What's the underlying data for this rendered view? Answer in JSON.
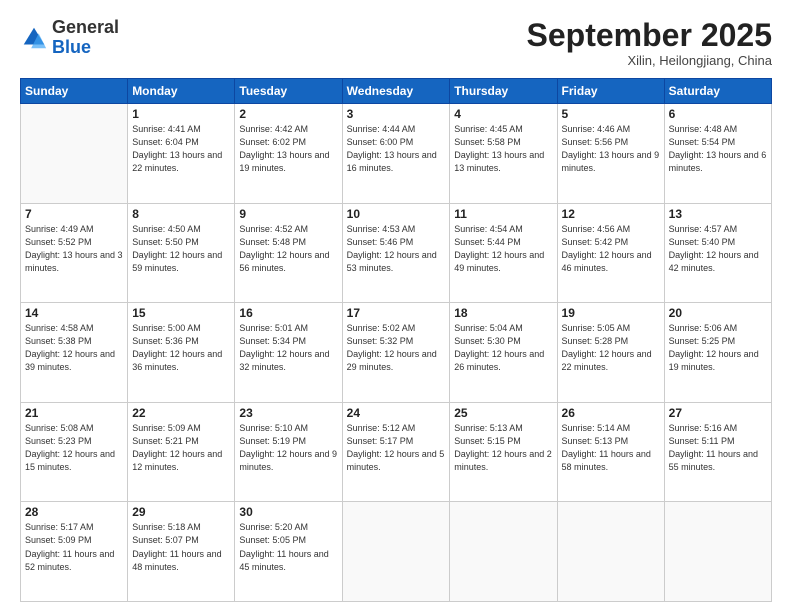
{
  "logo": {
    "general": "General",
    "blue": "Blue"
  },
  "header": {
    "month": "September 2025",
    "location": "Xilin, Heilongjiang, China"
  },
  "weekdays": [
    "Sunday",
    "Monday",
    "Tuesday",
    "Wednesday",
    "Thursday",
    "Friday",
    "Saturday"
  ],
  "weeks": [
    [
      {
        "day": "",
        "detail": ""
      },
      {
        "day": "1",
        "detail": "Sunrise: 4:41 AM\nSunset: 6:04 PM\nDaylight: 13 hours\nand 22 minutes."
      },
      {
        "day": "2",
        "detail": "Sunrise: 4:42 AM\nSunset: 6:02 PM\nDaylight: 13 hours\nand 19 minutes."
      },
      {
        "day": "3",
        "detail": "Sunrise: 4:44 AM\nSunset: 6:00 PM\nDaylight: 13 hours\nand 16 minutes."
      },
      {
        "day": "4",
        "detail": "Sunrise: 4:45 AM\nSunset: 5:58 PM\nDaylight: 13 hours\nand 13 minutes."
      },
      {
        "day": "5",
        "detail": "Sunrise: 4:46 AM\nSunset: 5:56 PM\nDaylight: 13 hours\nand 9 minutes."
      },
      {
        "day": "6",
        "detail": "Sunrise: 4:48 AM\nSunset: 5:54 PM\nDaylight: 13 hours\nand 6 minutes."
      }
    ],
    [
      {
        "day": "7",
        "detail": "Sunrise: 4:49 AM\nSunset: 5:52 PM\nDaylight: 13 hours\nand 3 minutes."
      },
      {
        "day": "8",
        "detail": "Sunrise: 4:50 AM\nSunset: 5:50 PM\nDaylight: 12 hours\nand 59 minutes."
      },
      {
        "day": "9",
        "detail": "Sunrise: 4:52 AM\nSunset: 5:48 PM\nDaylight: 12 hours\nand 56 minutes."
      },
      {
        "day": "10",
        "detail": "Sunrise: 4:53 AM\nSunset: 5:46 PM\nDaylight: 12 hours\nand 53 minutes."
      },
      {
        "day": "11",
        "detail": "Sunrise: 4:54 AM\nSunset: 5:44 PM\nDaylight: 12 hours\nand 49 minutes."
      },
      {
        "day": "12",
        "detail": "Sunrise: 4:56 AM\nSunset: 5:42 PM\nDaylight: 12 hours\nand 46 minutes."
      },
      {
        "day": "13",
        "detail": "Sunrise: 4:57 AM\nSunset: 5:40 PM\nDaylight: 12 hours\nand 42 minutes."
      }
    ],
    [
      {
        "day": "14",
        "detail": "Sunrise: 4:58 AM\nSunset: 5:38 PM\nDaylight: 12 hours\nand 39 minutes."
      },
      {
        "day": "15",
        "detail": "Sunrise: 5:00 AM\nSunset: 5:36 PM\nDaylight: 12 hours\nand 36 minutes."
      },
      {
        "day": "16",
        "detail": "Sunrise: 5:01 AM\nSunset: 5:34 PM\nDaylight: 12 hours\nand 32 minutes."
      },
      {
        "day": "17",
        "detail": "Sunrise: 5:02 AM\nSunset: 5:32 PM\nDaylight: 12 hours\nand 29 minutes."
      },
      {
        "day": "18",
        "detail": "Sunrise: 5:04 AM\nSunset: 5:30 PM\nDaylight: 12 hours\nand 26 minutes."
      },
      {
        "day": "19",
        "detail": "Sunrise: 5:05 AM\nSunset: 5:28 PM\nDaylight: 12 hours\nand 22 minutes."
      },
      {
        "day": "20",
        "detail": "Sunrise: 5:06 AM\nSunset: 5:25 PM\nDaylight: 12 hours\nand 19 minutes."
      }
    ],
    [
      {
        "day": "21",
        "detail": "Sunrise: 5:08 AM\nSunset: 5:23 PM\nDaylight: 12 hours\nand 15 minutes."
      },
      {
        "day": "22",
        "detail": "Sunrise: 5:09 AM\nSunset: 5:21 PM\nDaylight: 12 hours\nand 12 minutes."
      },
      {
        "day": "23",
        "detail": "Sunrise: 5:10 AM\nSunset: 5:19 PM\nDaylight: 12 hours\nand 9 minutes."
      },
      {
        "day": "24",
        "detail": "Sunrise: 5:12 AM\nSunset: 5:17 PM\nDaylight: 12 hours\nand 5 minutes."
      },
      {
        "day": "25",
        "detail": "Sunrise: 5:13 AM\nSunset: 5:15 PM\nDaylight: 12 hours\nand 2 minutes."
      },
      {
        "day": "26",
        "detail": "Sunrise: 5:14 AM\nSunset: 5:13 PM\nDaylight: 11 hours\nand 58 minutes."
      },
      {
        "day": "27",
        "detail": "Sunrise: 5:16 AM\nSunset: 5:11 PM\nDaylight: 11 hours\nand 55 minutes."
      }
    ],
    [
      {
        "day": "28",
        "detail": "Sunrise: 5:17 AM\nSunset: 5:09 PM\nDaylight: 11 hours\nand 52 minutes."
      },
      {
        "day": "29",
        "detail": "Sunrise: 5:18 AM\nSunset: 5:07 PM\nDaylight: 11 hours\nand 48 minutes."
      },
      {
        "day": "30",
        "detail": "Sunrise: 5:20 AM\nSunset: 5:05 PM\nDaylight: 11 hours\nand 45 minutes."
      },
      {
        "day": "",
        "detail": ""
      },
      {
        "day": "",
        "detail": ""
      },
      {
        "day": "",
        "detail": ""
      },
      {
        "day": "",
        "detail": ""
      }
    ]
  ]
}
